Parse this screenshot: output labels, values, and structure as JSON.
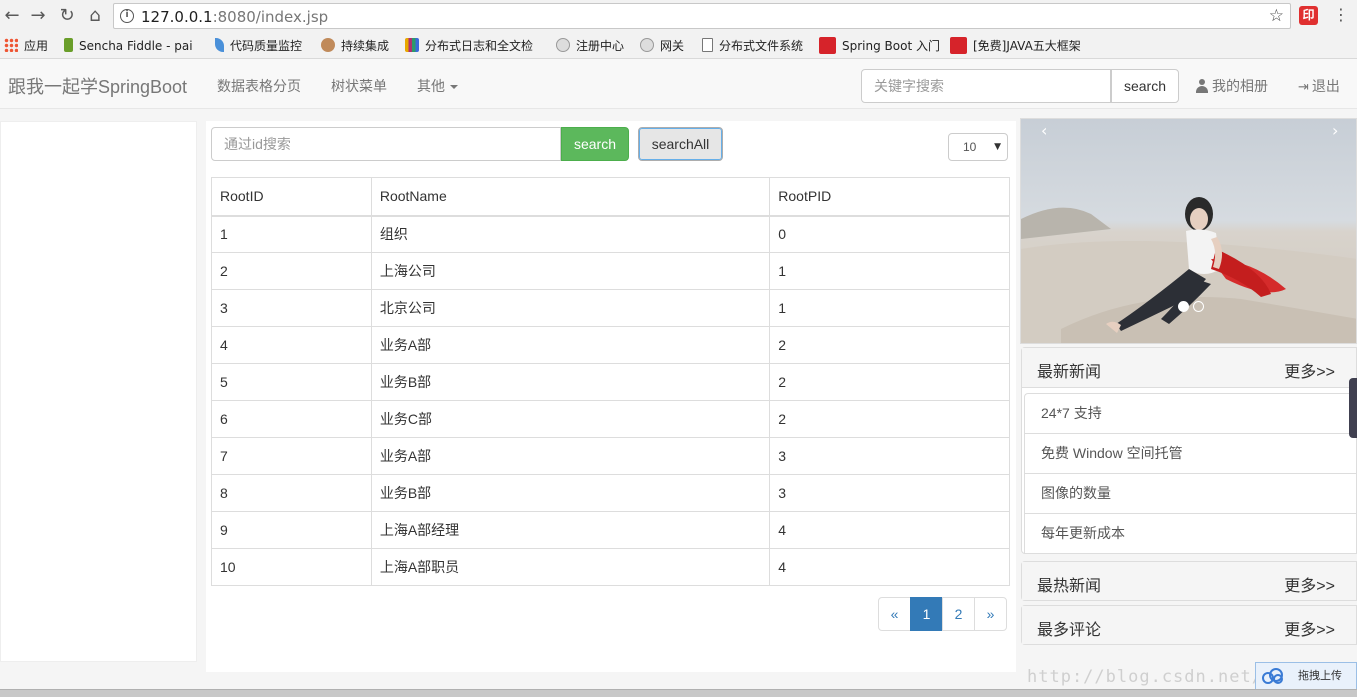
{
  "browser": {
    "url_host": "127.0.0.1",
    "url_path": ":8080/index.jsp",
    "bookmarks": [
      {
        "label": "应用",
        "color": "#e53"
      },
      {
        "label": "Sencha Fiddle - pai",
        "color": "#6a9e2a"
      },
      {
        "label": "代码质量监控",
        "color": "#4a90d9"
      },
      {
        "label": "持续集成",
        "color": "#c08a5a"
      },
      {
        "label": "分布式日志和全文检",
        "color": "#b03070"
      },
      {
        "label": "注册中心",
        "color": "#999"
      },
      {
        "label": "网关",
        "color": "#999"
      },
      {
        "label": "分布式文件系统",
        "color": "#ffffff"
      },
      {
        "label": "Spring Boot 入门",
        "color": "#d6232a"
      },
      {
        "label": "[免费]JAVA五大框架",
        "color": "#d6232a"
      }
    ],
    "ext_icon": "印"
  },
  "navbar": {
    "brand": "跟我一起学SpringBoot",
    "links": [
      "数据表格分页",
      "树状菜单",
      "其他"
    ],
    "search_placeholder": "关键字搜索",
    "search_button": "search",
    "album": "我的相册",
    "logout": "退出"
  },
  "main": {
    "id_search_placeholder": "通过id搜索",
    "search_button": "search",
    "search_all_button": "searchAll",
    "page_size": "10",
    "columns": [
      "RootID",
      "RootName",
      "RootPID"
    ],
    "rows": [
      [
        "1",
        "组织",
        "0"
      ],
      [
        "2",
        "上海公司",
        "1"
      ],
      [
        "3",
        "北京公司",
        "1"
      ],
      [
        "4",
        "业务A部",
        "2"
      ],
      [
        "5",
        "业务B部",
        "2"
      ],
      [
        "6",
        "业务C部",
        "2"
      ],
      [
        "7",
        "业务A部",
        "3"
      ],
      [
        "8",
        "业务B部",
        "3"
      ],
      [
        "9",
        "上海A部经理",
        "4"
      ],
      [
        "10",
        "上海A部职员",
        "4"
      ]
    ],
    "pagination": {
      "prev": "«",
      "pages": [
        "1",
        "2"
      ],
      "active": "1",
      "next": "»"
    }
  },
  "right": {
    "carousel": {
      "prev": "‹",
      "next": "›",
      "slides": 2,
      "active_slide": 1
    },
    "latest_news": {
      "title": "最新新闻",
      "more": "更多>>",
      "items": [
        "24*7 支持",
        "免费 Window 空间托管",
        "图像的数量",
        "每年更新成本"
      ]
    },
    "hot_news": {
      "title": "最热新闻",
      "more": "更多>>"
    },
    "most_comments": {
      "title": "最多评论",
      "more": "更多>>"
    }
  },
  "footer": {
    "watermark": "http://blog.csdn.net/qq",
    "upload_badge": "拖拽上传"
  },
  "colors": {
    "success": "#5cb85c",
    "primary": "#337ab7"
  }
}
